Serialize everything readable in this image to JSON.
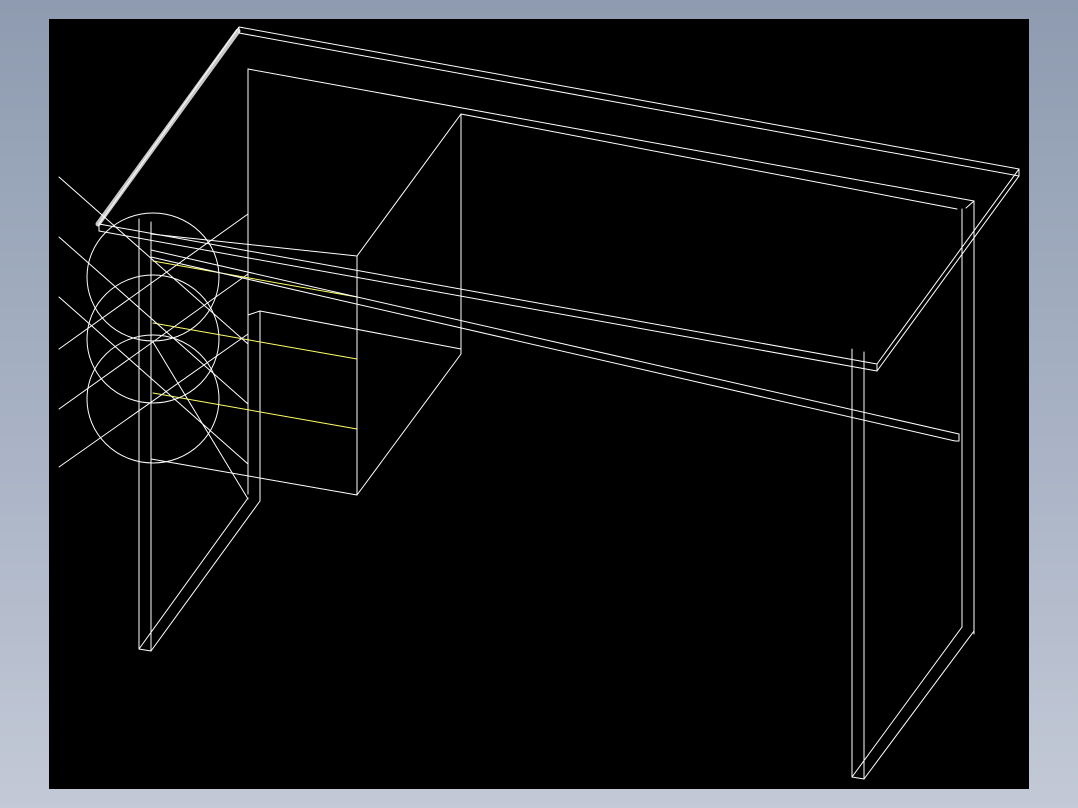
{
  "colors": {
    "background_outer": "#9aa5b8",
    "viewport": "#000000",
    "wire": "#ffffff",
    "drawer_edge": "#ffff66",
    "selected_edge": "#c8c8c8"
  },
  "viewport": {
    "label": "",
    "icon": "wireframe-desk-model"
  }
}
